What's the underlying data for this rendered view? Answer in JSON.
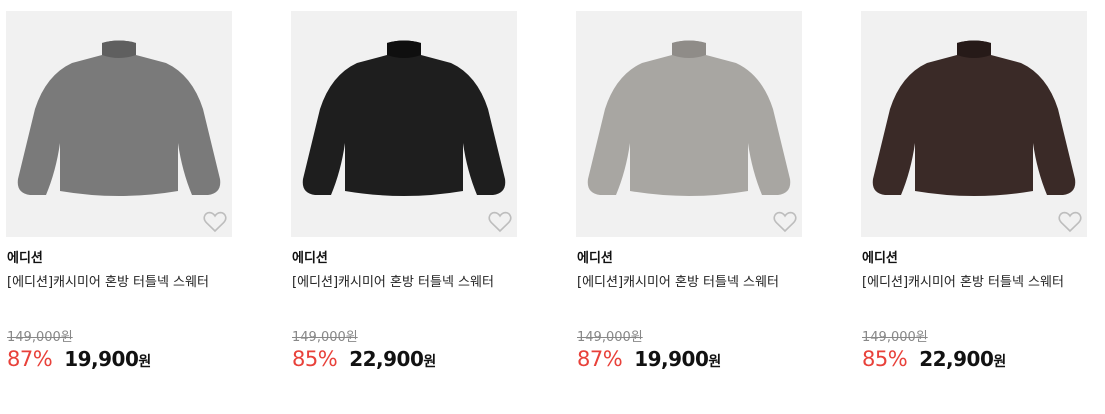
{
  "products": [
    {
      "brand": "에디션",
      "name": "[에디션]캐시미어 혼방 터틀넥 스웨터",
      "original_price": "149,000원",
      "discount": "87%",
      "price": "19,900",
      "currency": "원",
      "color": "#7a7a7a",
      "color_dark": "#5f5f5f"
    },
    {
      "brand": "에디션",
      "name": "[에디션]캐시미어 혼방 터틀넥 스웨터",
      "original_price": "149,000원",
      "discount": "85%",
      "price": "22,900",
      "currency": "원",
      "color": "#1e1e1e",
      "color_dark": "#0f0f0f"
    },
    {
      "brand": "에디션",
      "name": "[에디션]캐시미어 혼방 터틀넥 스웨터",
      "original_price": "149,000원",
      "discount": "87%",
      "price": "19,900",
      "currency": "원",
      "color": "#a8a6a2",
      "color_dark": "#8f8c88"
    },
    {
      "brand": "에디션",
      "name": "[에디션]캐시미어 혼방 터틀넥 스웨터",
      "original_price": "149,000원",
      "discount": "85%",
      "price": "22,900",
      "currency": "원",
      "color": "#3a2a27",
      "color_dark": "#261a18"
    }
  ],
  "wishlist_icon": "heart-outline-icon",
  "accent_color": "#e8413a"
}
